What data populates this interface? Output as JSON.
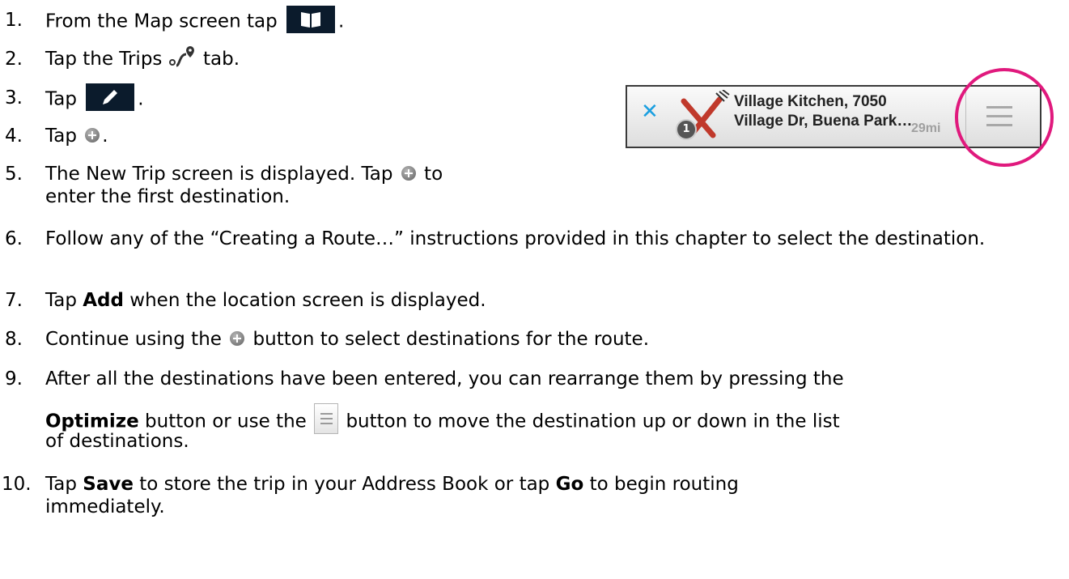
{
  "steps": [
    {
      "num": "1.",
      "text_a": "From the Map screen  tap ",
      "text_b": "."
    },
    {
      "num": "2.",
      "text_a": "Tap the Trips ",
      "text_b": " tab."
    },
    {
      "num": "3.",
      "text_a": "Tap ",
      "text_b": "."
    },
    {
      "num": "4.",
      "text_a": "Tap ",
      "text_b": "."
    },
    {
      "num": "5.",
      "text_a": "The New Trip screen is displayed.  Tap ",
      "text_b": " to",
      "line2": "enter the first destination."
    },
    {
      "num": "6.",
      "text": "Follow any of the “Creating a Route…” instructions provided in this chapter to select the destination."
    },
    {
      "num": "7.",
      "text_a": "Tap ",
      "bold": "Add",
      "text_b": " when the location screen is displayed."
    },
    {
      "num": "8.",
      "text_a": "Continue using the ",
      "text_b": " button to select destinations for the route."
    },
    {
      "num": "9.",
      "line1": "After all the destinations have been entered, you can rearrange them by pressing the",
      "bold": "Optimize",
      "text_a": " button or use the ",
      "text_b": " button to move the destination up or down in the list",
      "line3": "of destinations."
    },
    {
      "num": "10.",
      "text_a": "Tap ",
      "bold1": "Save",
      "text_b": " to store the trip in your Address Book or tap ",
      "bold2": "Go",
      "text_c": " to begin routing",
      "line2": "immediately."
    }
  ],
  "route_card": {
    "line1": "Village Kitchen, 7050",
    "line2": "Village Dr, Buena Park…",
    "distance": "29mi",
    "badge": "1"
  },
  "icons": [
    "book-icon",
    "trips-route-icon",
    "pencil-icon",
    "add-circle-icon",
    "reorder-menu-icon",
    "close-icon",
    "restaurant-icon"
  ],
  "colors": {
    "button_dark": "#0b1b2c",
    "highlight": "#e0197d",
    "close_blue": "#1a9fe0"
  }
}
